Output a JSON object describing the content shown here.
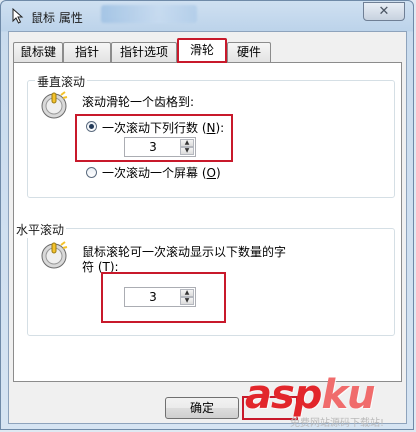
{
  "window": {
    "title": "鼠标 属性",
    "close_label": "✕"
  },
  "tabs": [
    {
      "label": "鼠标键"
    },
    {
      "label": "指针"
    },
    {
      "label": "指针选项"
    },
    {
      "label": "滑轮",
      "active": true
    },
    {
      "label": "硬件"
    }
  ],
  "vertical": {
    "group_title": "垂直滚动",
    "description": "滚动滑轮一个齿格到:",
    "option_lines": {
      "label": "一次滚动下列行数",
      "mnemonic": "N",
      "selected": true
    },
    "lines_value": "3",
    "option_screen": {
      "label": "一次滚动一个屏幕",
      "mnemonic": "O",
      "selected": false
    }
  },
  "horizontal": {
    "group_title": "水平滚动",
    "description_line1": "鼠标滚轮可一次滚动显示以下数量的字",
    "description_line2_prefix": "符",
    "description_mnemonic": "T",
    "chars_value": "3"
  },
  "buttons": {
    "ok_label": "确定"
  },
  "watermark": {
    "main_a": "asp",
    "main_b": "ku",
    "sub": "免费网站源码下载站!"
  },
  "colors": {
    "highlight": "#c8192b",
    "window_frame": "#bcd3ea"
  }
}
